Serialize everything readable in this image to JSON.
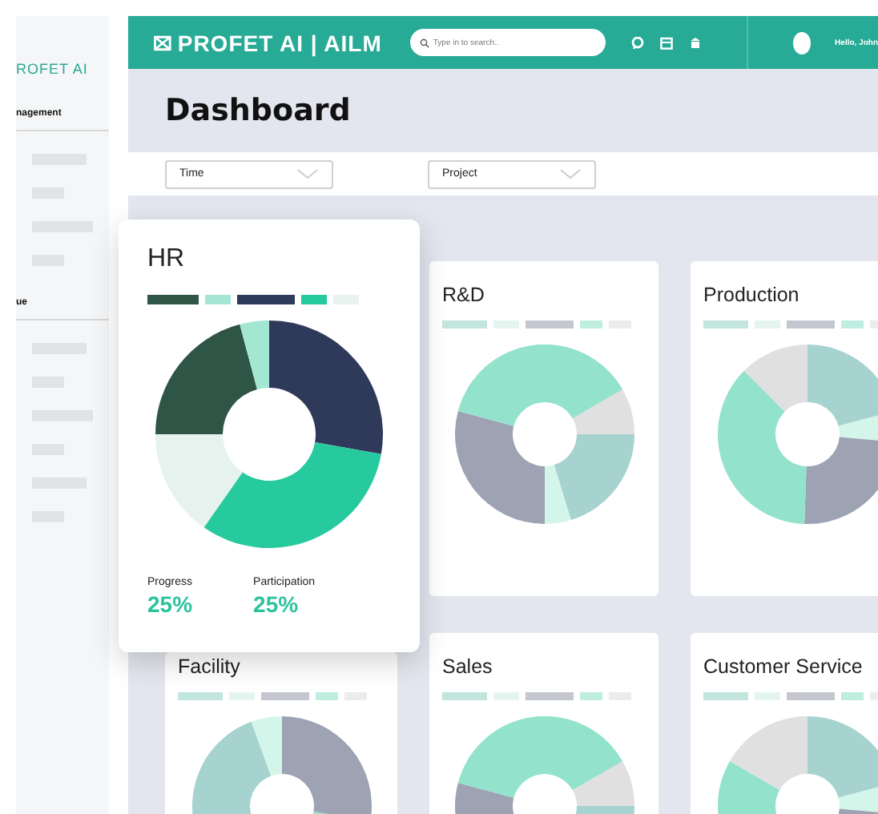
{
  "sidebar": {
    "brand": "ROFET AI",
    "sections": [
      {
        "heading": "nagement"
      },
      {
        "heading": "ue"
      }
    ]
  },
  "top_bar": {
    "logo": "PROFET AI | AILM",
    "search": {
      "placeholder": "Type in to search.."
    },
    "greeting": "Hello, John"
  },
  "page_title": "Dashboard",
  "filters": [
    {
      "label": "Time"
    },
    {
      "label": "Project"
    }
  ],
  "focused_card": {
    "title": "HR",
    "stats": [
      {
        "label": "Progress",
        "value": "25%"
      },
      {
        "label": "Participation",
        "value": "25%"
      }
    ]
  },
  "cards": [
    {
      "title": "R&D"
    },
    {
      "title": "Production"
    },
    {
      "title": "Facility"
    },
    {
      "title": "Sales"
    },
    {
      "title": "Customer Service"
    }
  ]
}
